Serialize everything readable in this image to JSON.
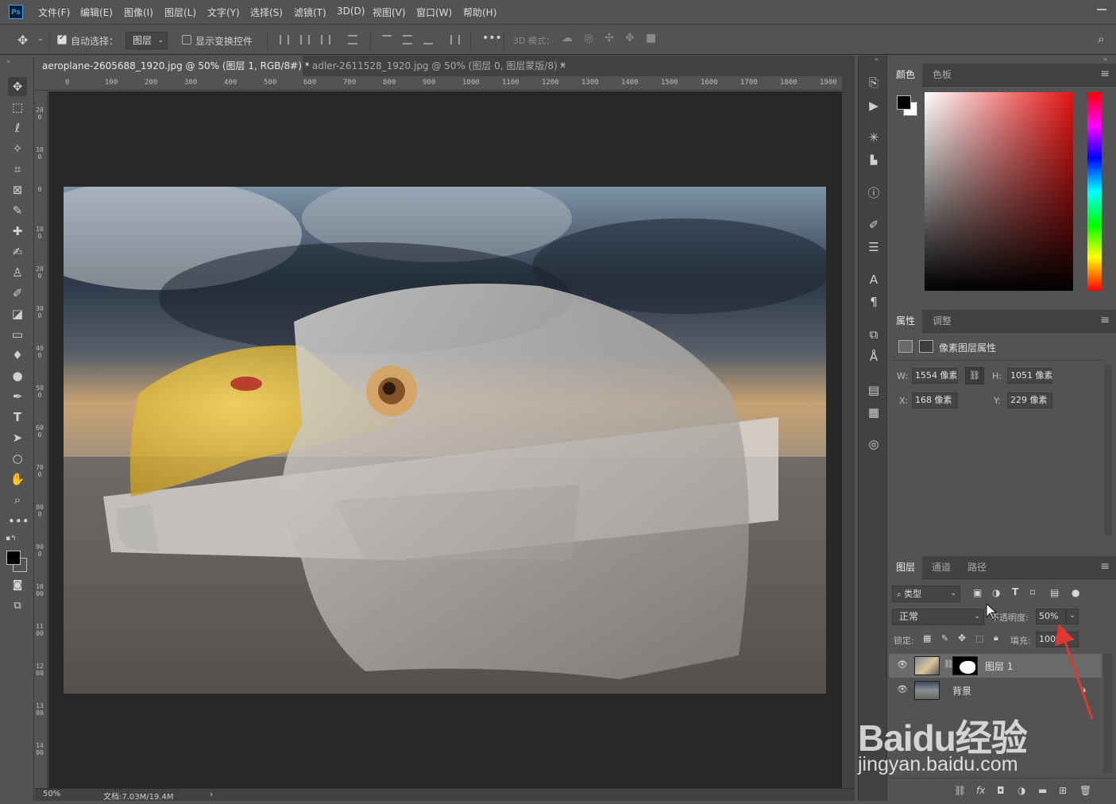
{
  "app": {
    "logo": "Ps"
  },
  "menu": [
    "文件(F)",
    "编辑(E)",
    "图像(I)",
    "图层(L)",
    "文字(Y)",
    "选择(S)",
    "滤镜(T)",
    "3D(D)",
    "视图(V)",
    "窗口(W)",
    "帮助(H)"
  ],
  "options": {
    "auto_select_label": "自动选择：",
    "auto_select_value": "图层",
    "show_transform_label": "显示变换控件",
    "mode_3d_label": "3D 模式："
  },
  "tabs": [
    {
      "title": "aeroplane-2605688_1920.jpg @ 50% (图层 1, RGB/8#) *",
      "close": "×",
      "active": true
    },
    {
      "title": "adler-2611528_1920.jpg @ 50% (图层 0, 图层蒙版/8) *",
      "close": "×",
      "active": false
    }
  ],
  "ruler_top": [
    "0",
    "100",
    "200",
    "300",
    "400",
    "500",
    "600",
    "700",
    "800",
    "900",
    "1000",
    "1100",
    "1200",
    "1300",
    "1400",
    "1500",
    "1600",
    "1700",
    "1800",
    "1900"
  ],
  "ruler_left": [
    "200",
    "100",
    "0",
    "100",
    "200",
    "300",
    "400",
    "500",
    "600",
    "700",
    "800",
    "900",
    "1000",
    "1100",
    "1200",
    "1300",
    "1400"
  ],
  "status": {
    "zoom": "50%",
    "doc": "文档:7.03M/19.4M",
    "arrow": "›"
  },
  "color_panel": {
    "tab_color": "颜色",
    "tab_swatches": "色板",
    "menu_icon": "≡"
  },
  "props_panel": {
    "tab_properties": "属性",
    "tab_adjust": "调整",
    "title": "像素图层属性",
    "w_label": "W:",
    "w_value": "1554 像素",
    "h_label": "H:",
    "h_value": "1051 像素",
    "x_label": "X:",
    "x_value": "168 像素",
    "y_label": "Y:",
    "y_value": "229 像素"
  },
  "layers_panel": {
    "tab_layers": "图层",
    "tab_channels": "通道",
    "tab_paths": "路径",
    "filter_kind": "类型",
    "blend_mode": "正常",
    "opacity_label": "不透明度:",
    "opacity_value": "50%",
    "lock_label": "锁定:",
    "fill_label": "填充:",
    "fill_value": "100%",
    "layers": [
      {
        "name": "图层 1",
        "visible": true,
        "selected": true
      },
      {
        "name": "背景",
        "visible": true,
        "selected": false
      }
    ]
  },
  "watermark": {
    "brand": "Baidu经验",
    "url": "jingyan.baidu.com"
  },
  "colors": {
    "ui_bg": "#535353",
    "panel_dark": "#424242",
    "canvas_bg": "#282828",
    "arrow": "#e0382e",
    "foreground": "#000000",
    "background": "#ffffff"
  }
}
